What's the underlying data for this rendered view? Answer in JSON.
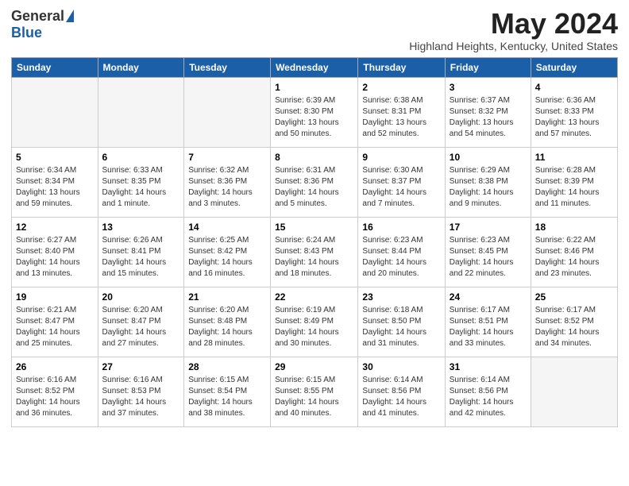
{
  "logo": {
    "general": "General",
    "blue": "Blue"
  },
  "title": "May 2024",
  "subtitle": "Highland Heights, Kentucky, United States",
  "days_of_week": [
    "Sunday",
    "Monday",
    "Tuesday",
    "Wednesday",
    "Thursday",
    "Friday",
    "Saturday"
  ],
  "weeks": [
    [
      {
        "day": "",
        "info": ""
      },
      {
        "day": "",
        "info": ""
      },
      {
        "day": "",
        "info": ""
      },
      {
        "day": "1",
        "info": "Sunrise: 6:39 AM\nSunset: 8:30 PM\nDaylight: 13 hours\nand 50 minutes."
      },
      {
        "day": "2",
        "info": "Sunrise: 6:38 AM\nSunset: 8:31 PM\nDaylight: 13 hours\nand 52 minutes."
      },
      {
        "day": "3",
        "info": "Sunrise: 6:37 AM\nSunset: 8:32 PM\nDaylight: 13 hours\nand 54 minutes."
      },
      {
        "day": "4",
        "info": "Sunrise: 6:36 AM\nSunset: 8:33 PM\nDaylight: 13 hours\nand 57 minutes."
      }
    ],
    [
      {
        "day": "5",
        "info": "Sunrise: 6:34 AM\nSunset: 8:34 PM\nDaylight: 13 hours\nand 59 minutes."
      },
      {
        "day": "6",
        "info": "Sunrise: 6:33 AM\nSunset: 8:35 PM\nDaylight: 14 hours\nand 1 minute."
      },
      {
        "day": "7",
        "info": "Sunrise: 6:32 AM\nSunset: 8:36 PM\nDaylight: 14 hours\nand 3 minutes."
      },
      {
        "day": "8",
        "info": "Sunrise: 6:31 AM\nSunset: 8:36 PM\nDaylight: 14 hours\nand 5 minutes."
      },
      {
        "day": "9",
        "info": "Sunrise: 6:30 AM\nSunset: 8:37 PM\nDaylight: 14 hours\nand 7 minutes."
      },
      {
        "day": "10",
        "info": "Sunrise: 6:29 AM\nSunset: 8:38 PM\nDaylight: 14 hours\nand 9 minutes."
      },
      {
        "day": "11",
        "info": "Sunrise: 6:28 AM\nSunset: 8:39 PM\nDaylight: 14 hours\nand 11 minutes."
      }
    ],
    [
      {
        "day": "12",
        "info": "Sunrise: 6:27 AM\nSunset: 8:40 PM\nDaylight: 14 hours\nand 13 minutes."
      },
      {
        "day": "13",
        "info": "Sunrise: 6:26 AM\nSunset: 8:41 PM\nDaylight: 14 hours\nand 15 minutes."
      },
      {
        "day": "14",
        "info": "Sunrise: 6:25 AM\nSunset: 8:42 PM\nDaylight: 14 hours\nand 16 minutes."
      },
      {
        "day": "15",
        "info": "Sunrise: 6:24 AM\nSunset: 8:43 PM\nDaylight: 14 hours\nand 18 minutes."
      },
      {
        "day": "16",
        "info": "Sunrise: 6:23 AM\nSunset: 8:44 PM\nDaylight: 14 hours\nand 20 minutes."
      },
      {
        "day": "17",
        "info": "Sunrise: 6:23 AM\nSunset: 8:45 PM\nDaylight: 14 hours\nand 22 minutes."
      },
      {
        "day": "18",
        "info": "Sunrise: 6:22 AM\nSunset: 8:46 PM\nDaylight: 14 hours\nand 23 minutes."
      }
    ],
    [
      {
        "day": "19",
        "info": "Sunrise: 6:21 AM\nSunset: 8:47 PM\nDaylight: 14 hours\nand 25 minutes."
      },
      {
        "day": "20",
        "info": "Sunrise: 6:20 AM\nSunset: 8:47 PM\nDaylight: 14 hours\nand 27 minutes."
      },
      {
        "day": "21",
        "info": "Sunrise: 6:20 AM\nSunset: 8:48 PM\nDaylight: 14 hours\nand 28 minutes."
      },
      {
        "day": "22",
        "info": "Sunrise: 6:19 AM\nSunset: 8:49 PM\nDaylight: 14 hours\nand 30 minutes."
      },
      {
        "day": "23",
        "info": "Sunrise: 6:18 AM\nSunset: 8:50 PM\nDaylight: 14 hours\nand 31 minutes."
      },
      {
        "day": "24",
        "info": "Sunrise: 6:17 AM\nSunset: 8:51 PM\nDaylight: 14 hours\nand 33 minutes."
      },
      {
        "day": "25",
        "info": "Sunrise: 6:17 AM\nSunset: 8:52 PM\nDaylight: 14 hours\nand 34 minutes."
      }
    ],
    [
      {
        "day": "26",
        "info": "Sunrise: 6:16 AM\nSunset: 8:52 PM\nDaylight: 14 hours\nand 36 minutes."
      },
      {
        "day": "27",
        "info": "Sunrise: 6:16 AM\nSunset: 8:53 PM\nDaylight: 14 hours\nand 37 minutes."
      },
      {
        "day": "28",
        "info": "Sunrise: 6:15 AM\nSunset: 8:54 PM\nDaylight: 14 hours\nand 38 minutes."
      },
      {
        "day": "29",
        "info": "Sunrise: 6:15 AM\nSunset: 8:55 PM\nDaylight: 14 hours\nand 40 minutes."
      },
      {
        "day": "30",
        "info": "Sunrise: 6:14 AM\nSunset: 8:56 PM\nDaylight: 14 hours\nand 41 minutes."
      },
      {
        "day": "31",
        "info": "Sunrise: 6:14 AM\nSunset: 8:56 PM\nDaylight: 14 hours\nand 42 minutes."
      },
      {
        "day": "",
        "info": ""
      }
    ]
  ]
}
